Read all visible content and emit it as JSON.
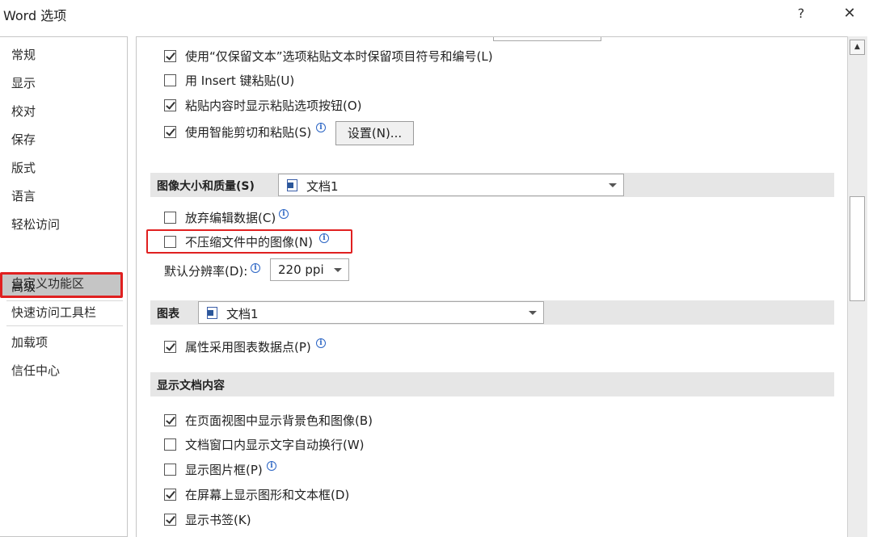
{
  "window": {
    "title": "Word 选项",
    "help_label": "?",
    "close_label": "✕"
  },
  "sidebar": {
    "items": [
      {
        "label": "常规"
      },
      {
        "label": "显示"
      },
      {
        "label": "校对"
      },
      {
        "label": "保存"
      },
      {
        "label": "版式"
      },
      {
        "label": "语言"
      },
      {
        "label": "轻松访问"
      },
      {
        "label": "高级",
        "selected": true
      },
      {
        "label": "自定义功能区"
      },
      {
        "label": "快速访问工具栏"
      },
      {
        "label": "加载项"
      },
      {
        "label": "信任中心"
      }
    ]
  },
  "paste_options": {
    "keep_bullets_label": "使用“仅保留文本”选项粘贴文本时保留项目符号和编号(L)",
    "keep_bullets_checked": true,
    "insert_key_label": "用 Insert 键粘贴(U)",
    "insert_key_checked": false,
    "show_paste_button_label": "粘贴内容时显示粘贴选项按钮(O)",
    "show_paste_button_checked": true,
    "smart_cut_label": "使用智能剪切和粘贴(S)",
    "smart_cut_checked": true,
    "settings_button": "设置(N)..."
  },
  "image_quality": {
    "section_title": "图像大小和质量(S)",
    "document": "文档1",
    "discard_edit_label": "放弃编辑数据(C)",
    "discard_edit_checked": false,
    "no_compress_label": "不压缩文件中的图像(N)",
    "no_compress_checked": false,
    "resolution_label": "默认分辨率(D):",
    "resolution_value": "220 ppi"
  },
  "chart": {
    "section_title": "图表",
    "document": "文档1",
    "property_label": "属性采用图表数据点(P)",
    "property_checked": true
  },
  "display_content": {
    "section_title": "显示文档内容",
    "items": [
      {
        "label": "在页面视图中显示背景色和图像(B)",
        "checked": true
      },
      {
        "label": "文档窗口内显示文字自动换行(W)",
        "checked": false
      },
      {
        "label": "显示图片框(P)",
        "checked": false
      },
      {
        "label": "在屏幕上显示图形和文本框(D)",
        "checked": true
      },
      {
        "label": "显示书签(K)",
        "checked": true
      }
    ]
  }
}
